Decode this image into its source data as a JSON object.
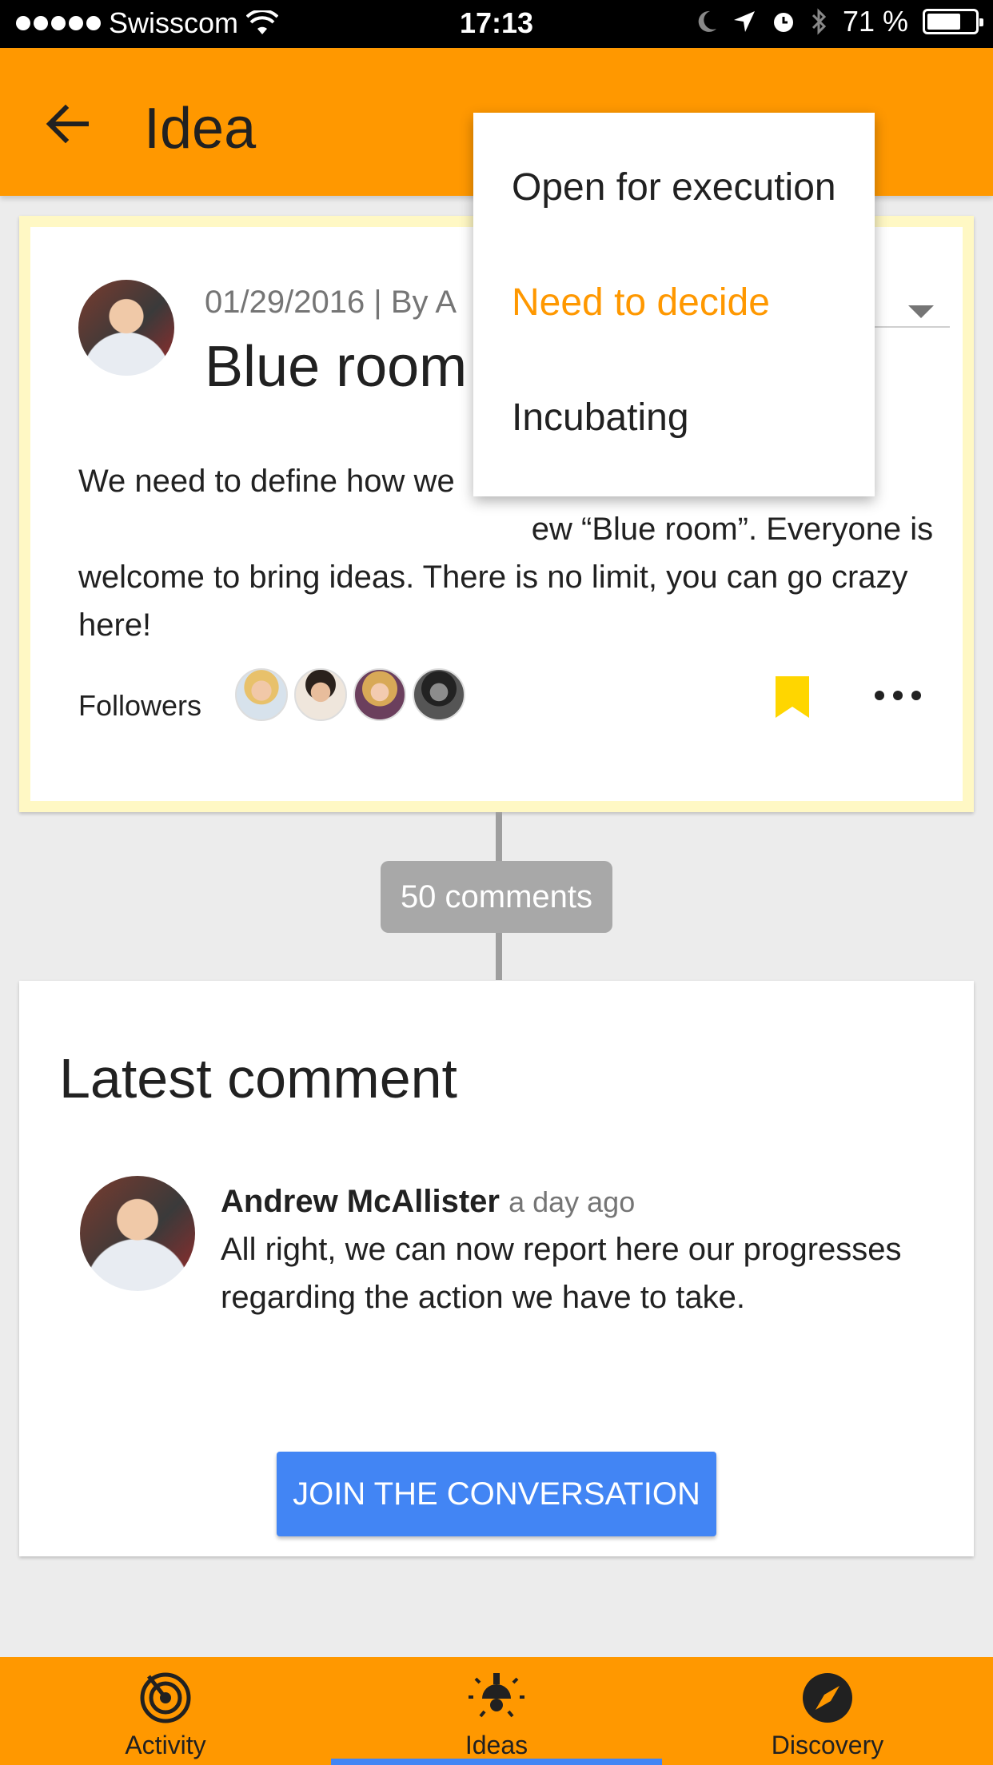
{
  "status_bar": {
    "carrier": "Swisscom",
    "time": "17:13",
    "battery": "71 %",
    "battery_level": 0.71
  },
  "app_bar": {
    "title": "Idea",
    "back_icon": "arrow-back-icon",
    "color": "#ff9800"
  },
  "idea": {
    "meta": "01/29/2016 | By A",
    "title": "Blue room",
    "description": "We need to define how we                                                    ew “Blue room”. Everyone is welcome to bring ideas. There is no limit, you can go crazy here!",
    "followers_label": "Followers",
    "bookmark_color": "#ffd600"
  },
  "status_menu": {
    "options": [
      "Open for execution",
      "Need to decide",
      "Incubating"
    ],
    "selected": "Need to decide",
    "selected_color": "#ff9800"
  },
  "comments_count": "50 comments",
  "latest_comment": {
    "heading": "Latest comment",
    "author": "Andrew McAllister",
    "time": "a day ago",
    "body": "All right, we can now report here our progresses regarding the action we have to take.",
    "cta": "JOIN THE CONVERSATION",
    "cta_color": "#4285f4"
  },
  "bottom_nav": {
    "items": [
      {
        "label": "Activity",
        "icon": "activity-icon"
      },
      {
        "label": "Ideas",
        "icon": "lightbulb-icon"
      },
      {
        "label": "Discovery",
        "icon": "compass-icon"
      }
    ],
    "active": "Ideas"
  }
}
